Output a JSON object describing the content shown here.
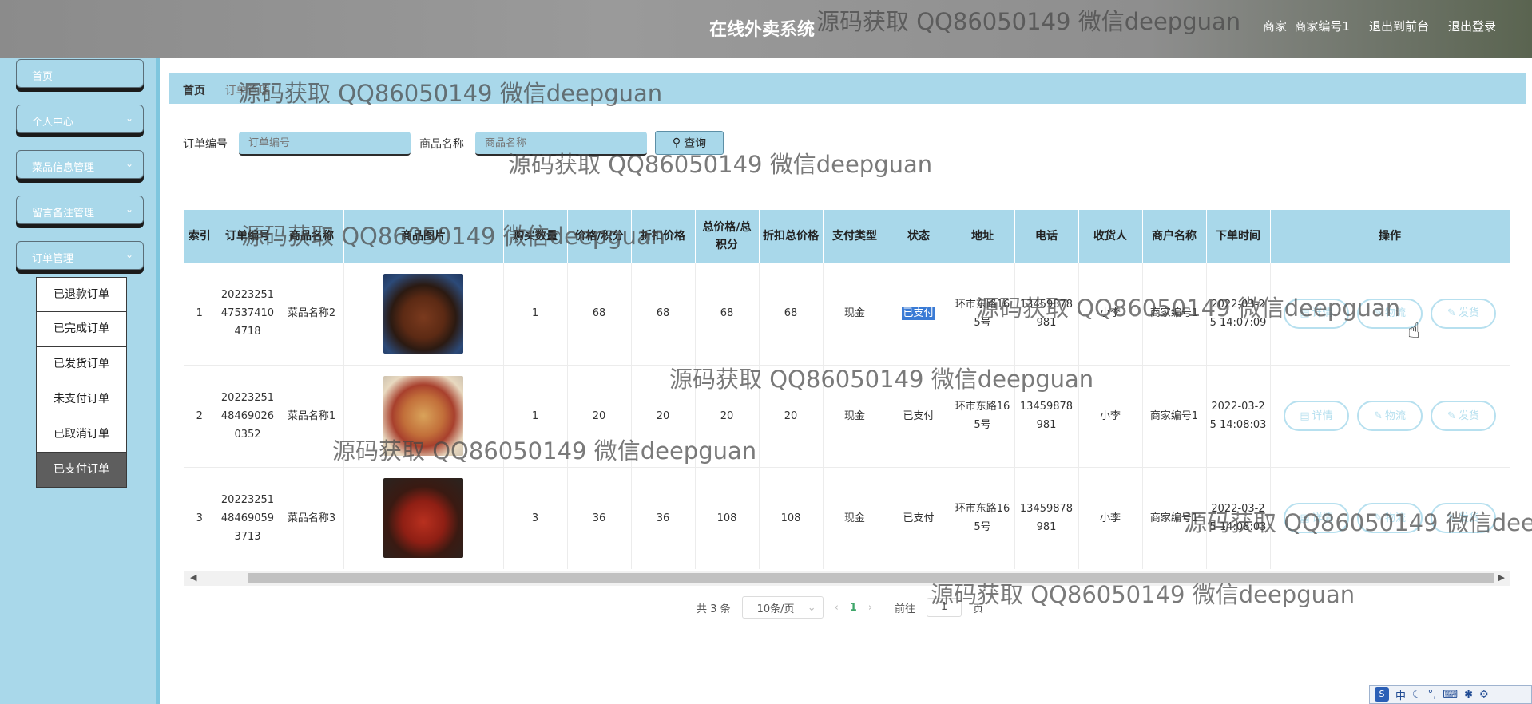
{
  "header": {
    "title": "在线外卖系统",
    "user_role": "商家",
    "user_name": "商家编号1",
    "front_link": "退出到前台",
    "logout_link": "退出登录"
  },
  "sidebar": {
    "items": [
      {
        "label": "首页",
        "has_chevron": false
      },
      {
        "label": "个人中心",
        "has_chevron": true
      },
      {
        "label": "菜品信息管理",
        "has_chevron": true
      },
      {
        "label": "留言备注管理",
        "has_chevron": true
      },
      {
        "label": "订单管理",
        "has_chevron": true
      }
    ],
    "submenu": [
      {
        "label": "已退款订单",
        "active": false
      },
      {
        "label": "已完成订单",
        "active": false
      },
      {
        "label": "已发货订单",
        "active": false
      },
      {
        "label": "未支付订单",
        "active": false
      },
      {
        "label": "已取消订单",
        "active": false
      },
      {
        "label": "已支付订单",
        "active": true
      }
    ]
  },
  "breadcrumb": {
    "home": "首页",
    "current": "订单管理"
  },
  "search": {
    "order_label": "订单编号",
    "order_placeholder": "订单编号",
    "product_label": "商品名称",
    "product_placeholder": "商品名称",
    "query_button": "查询"
  },
  "table": {
    "columns": [
      "索引",
      "订单编号",
      "商品名称",
      "商品图片",
      "购买数量",
      "价格/积分",
      "折扣价格",
      "总价格/总积分",
      "折扣总价格",
      "支付类型",
      "状态",
      "地址",
      "电话",
      "收货人",
      "商户名称",
      "下单时间",
      "操作"
    ],
    "rows": [
      {
        "index": "1",
        "order_no": "20223251475374104718",
        "product": "菜品名称2",
        "qty": "1",
        "price": "68",
        "discount_price": "68",
        "total": "68",
        "discount_total": "68",
        "pay_type": "现金",
        "status": "已支付",
        "address": "环市东路165号",
        "phone": "13459878981",
        "receiver": "小李",
        "merchant": "商家编号1",
        "order_time": "2022-03-25 14:07:09"
      },
      {
        "index": "2",
        "order_no": "20223251484690260352",
        "product": "菜品名称1",
        "qty": "1",
        "price": "20",
        "discount_price": "20",
        "total": "20",
        "discount_total": "20",
        "pay_type": "现金",
        "status": "已支付",
        "address": "环市东路165号",
        "phone": "13459878981",
        "receiver": "小李",
        "merchant": "商家编号1",
        "order_time": "2022-03-25 14:08:03"
      },
      {
        "index": "3",
        "order_no": "20223251484690593713",
        "product": "菜品名称3",
        "qty": "3",
        "price": "36",
        "discount_price": "36",
        "total": "108",
        "discount_total": "108",
        "pay_type": "现金",
        "status": "已支付",
        "address": "环市东路165号",
        "phone": "13459878981",
        "receiver": "小李",
        "merchant": "商家编号1",
        "order_time": "2022-03-25 14:08:03"
      }
    ],
    "actions": {
      "detail": "详情",
      "logistics": "物流",
      "ship": "发货"
    }
  },
  "pagination": {
    "total_prefix": "共",
    "total": "3",
    "total_suffix": "条",
    "page_size": "10条/页",
    "current_page": "1",
    "goto_prefix": "前往",
    "goto_value": "1",
    "goto_suffix": "页"
  },
  "ime": {
    "lang": "中"
  },
  "watermark": "源码获取 QQ86050149 微信deepguan",
  "colors": {
    "accent": "#a9d8ea",
    "header": "#8e8e8e",
    "active_submenu": "#5e5e5e"
  }
}
